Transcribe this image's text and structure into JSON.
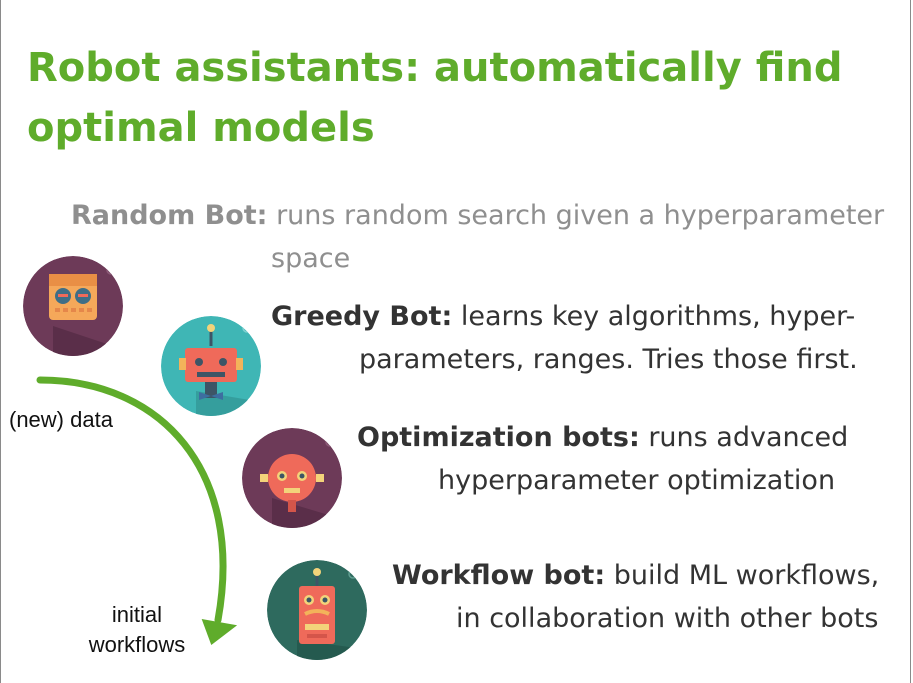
{
  "title": "Robot assistants: automatically find optimal models",
  "bots": {
    "random": {
      "name": "Random Bot:",
      "line1": " runs random search given a hyperparameter",
      "line2": "space"
    },
    "greedy": {
      "name": "Greedy Bot:",
      "line1": " learns key algorithms, hyper-",
      "line2": "parameters, ranges. Tries those first."
    },
    "optimization": {
      "name": "Optimization bots:",
      "line1": " runs advanced",
      "line2": "hyperparameter optimization"
    },
    "workflow": {
      "name": "Workflow bot:",
      "line1": " build ML workflows,",
      "line2": "in collaboration with other bots"
    }
  },
  "labels": {
    "new_data": "(new) data",
    "initial_line1": "initial",
    "initial_line2": "workflows"
  },
  "colors": {
    "title": "#5fac2b",
    "arrow": "#5fac2b",
    "random_text": "#8f8f8f",
    "body_text": "#333333"
  },
  "icons": [
    "robot-icon-purple",
    "robot-icon-teal",
    "robot-icon-red",
    "robot-icon-green"
  ]
}
